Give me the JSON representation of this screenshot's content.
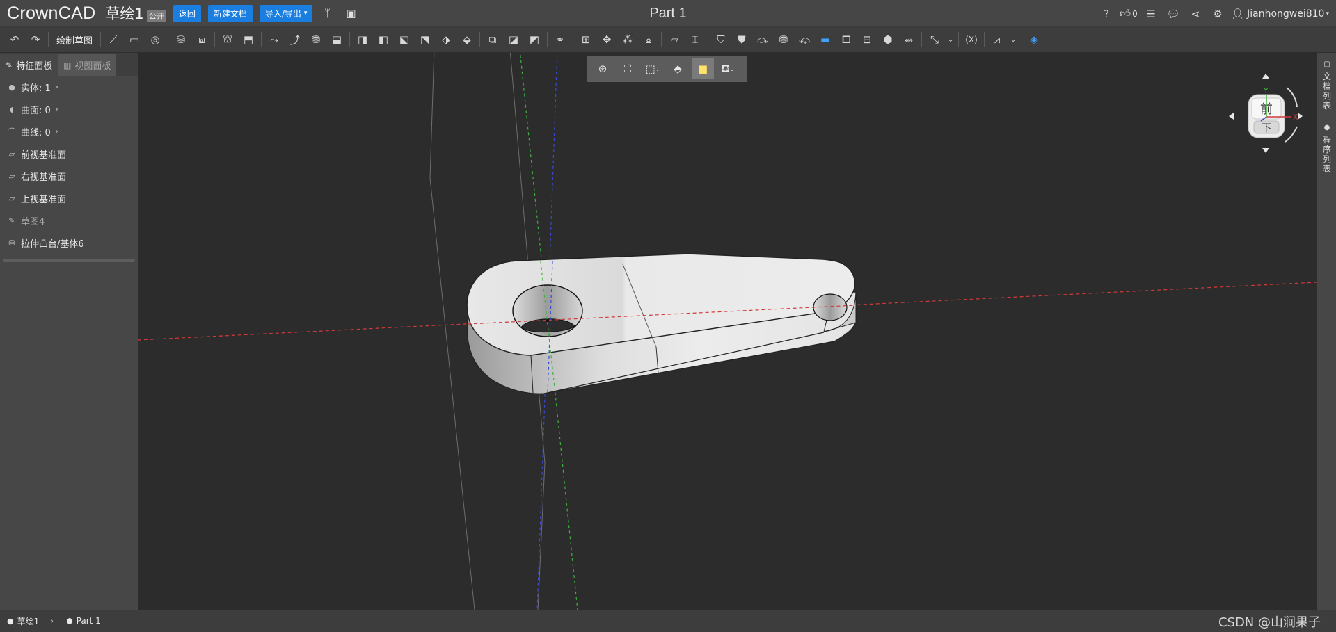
{
  "app": {
    "logo": "CrownCAD",
    "doc_title": "草绘1",
    "public_badge": "公开",
    "part_title": "Part 1"
  },
  "header": {
    "back_label": "返回",
    "new_doc_label": "新建文档",
    "import_export_label": "导入/导出",
    "like_count": "0",
    "user_name": "Jianhongwei810"
  },
  "toolbar": {
    "sketch_label": "绘制草图"
  },
  "left_panel": {
    "tabs": [
      {
        "label": "特征面板",
        "active": true
      },
      {
        "label": "视图面板",
        "active": false
      }
    ],
    "counts": [
      {
        "label": "实体: 1"
      },
      {
        "label": "曲面: 0"
      },
      {
        "label": "曲线: 0"
      }
    ],
    "features": [
      {
        "label": "前视基准面",
        "dim": false
      },
      {
        "label": "右视基准面",
        "dim": false
      },
      {
        "label": "上视基准面",
        "dim": false
      },
      {
        "label": "草图4",
        "dim": true
      },
      {
        "label": "拉伸凸台/基体6",
        "dim": false
      }
    ]
  },
  "viewcube": {
    "front_label": "前",
    "bottom_label": "下",
    "axis_x": "X",
    "axis_y": "Y"
  },
  "right_bar": {
    "tabs": [
      "文档列表",
      "程序列表"
    ]
  },
  "status_bar": {
    "crumbs": [
      "草绘1",
      "Part 1"
    ],
    "watermark": "CSDN @山涧果子"
  },
  "colors": {
    "accent": "#1a7ee0",
    "x_axis": "#d23a3a",
    "y_axis": "#3fb23f",
    "z_axis": "#3a4ad6",
    "highlight": "#ffe26a"
  }
}
